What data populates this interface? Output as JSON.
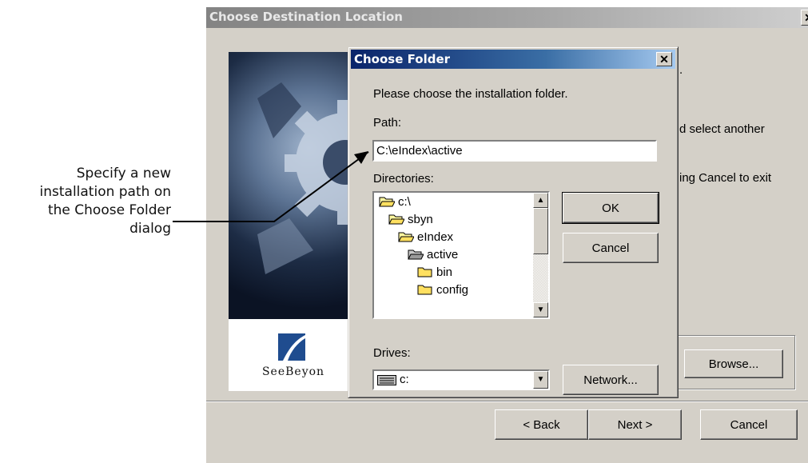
{
  "annotation": {
    "lines": [
      "Specify a new",
      "installation path on",
      "the Choose Folder",
      "dialog"
    ]
  },
  "outer_window": {
    "title": "Choose Destination Location",
    "close_glyph": "✕",
    "body_text_1": ".",
    "body_text_2": "d select another",
    "body_text_3": "ing Cancel to exit",
    "logo_text": "SeeBeyon",
    "browse_label": "Browse...",
    "back_label": "< Back",
    "next_label": "Next >",
    "cancel_label": "Cancel"
  },
  "dialog": {
    "title": "Choose Folder",
    "close_glyph": "✕",
    "prompt": "Please choose the installation folder.",
    "path_label": "Path:",
    "path_value": "C:\\eIndex\\active",
    "directories_label": "Directories:",
    "directories": [
      {
        "name": "c:\\",
        "state": "open"
      },
      {
        "name": "sbyn",
        "state": "open"
      },
      {
        "name": "eIndex",
        "state": "open"
      },
      {
        "name": "active",
        "state": "selected-open"
      },
      {
        "name": "bin",
        "state": "closed"
      },
      {
        "name": "config",
        "state": "closed"
      }
    ],
    "drives_label": "Drives:",
    "drive_value": "c:",
    "ok_label": "OK",
    "cancel_label": "Cancel",
    "network_label": "Network...",
    "scroll_up_glyph": "▲",
    "scroll_down_glyph": "▼",
    "combo_glyph": "▼"
  },
  "colors": {
    "dialog_face": "#d4d0c8",
    "active_title": "#0a246a",
    "inactive_title": "#838383"
  }
}
